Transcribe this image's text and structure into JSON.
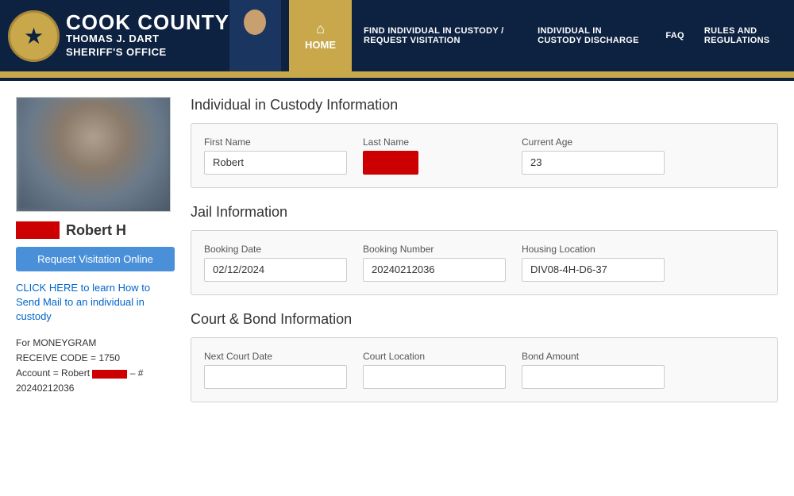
{
  "header": {
    "badge_star": "★",
    "county": "COOK COUNTY",
    "name_line1": "THOMAS J. DART",
    "name_line2": "SHERIFF'S OFFICE",
    "nav_home": "HOME",
    "nav_home_icon": "⌂",
    "nav_links": [
      "FIND INDIVIDUAL IN CUSTODY / REQUEST VISITATION",
      "INDIVIDUAL IN CUSTODY DISCHARGE",
      "FAQ",
      "RULES AND REGULATIONS"
    ]
  },
  "sidebar": {
    "person_name": "Robert H",
    "visitation_btn_label": "Request Visitation Online",
    "mail_link_text": "CLICK HERE to learn How to Send Mail to an individual in custody",
    "moneygram_line1": "For MONEYGRAM",
    "moneygram_line2": "RECEIVE CODE = 1750",
    "moneygram_line3": "Account = Robert",
    "moneygram_line4": "– # 20240212036"
  },
  "individual_section": {
    "title": "Individual in Custody Information",
    "first_name_label": "First Name",
    "first_name_value": "Robert",
    "last_name_label": "Last Name",
    "age_label": "Current Age",
    "age_value": "23"
  },
  "jail_section": {
    "title": "Jail Information",
    "booking_date_label": "Booking Date",
    "booking_date_value": "02/12/2024",
    "booking_number_label": "Booking Number",
    "booking_number_value": "20240212036",
    "housing_label": "Housing Location",
    "housing_value": "DIV08-4H-D6-37"
  },
  "court_section": {
    "title": "Court & Bond Information",
    "next_court_label": "Next Court Date",
    "next_court_value": "",
    "court_location_label": "Court Location",
    "court_location_value": "",
    "bond_amount_label": "Bond Amount",
    "bond_amount_value": ""
  }
}
